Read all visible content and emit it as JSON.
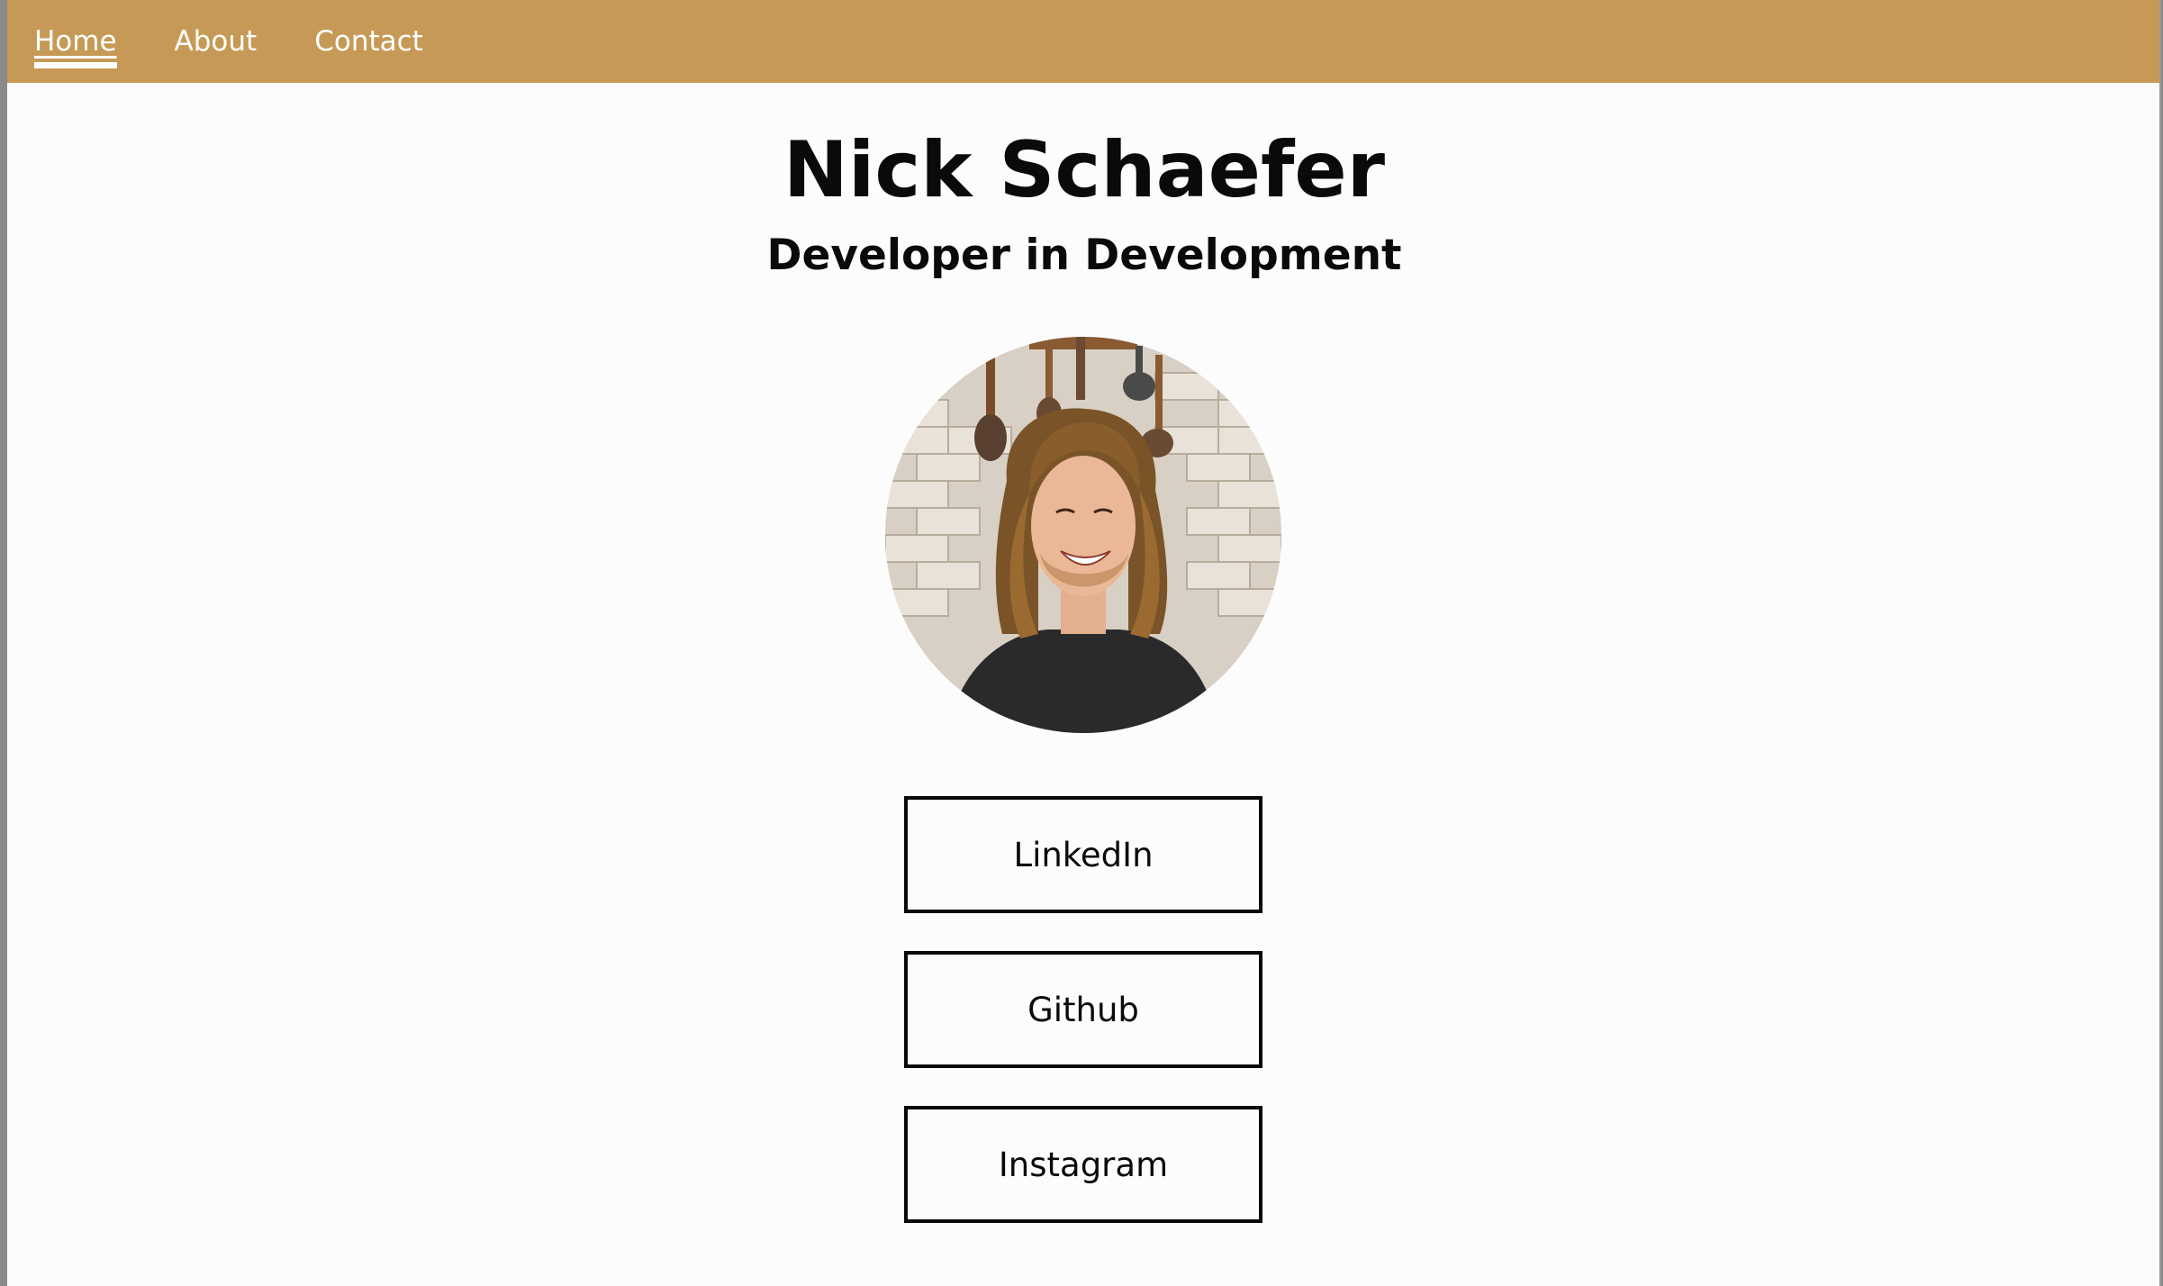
{
  "nav": {
    "items": [
      {
        "label": "Home",
        "active": true
      },
      {
        "label": "About",
        "active": false
      },
      {
        "label": "Contact",
        "active": false
      }
    ]
  },
  "hero": {
    "title": "Nick Schaefer",
    "subtitle": "Developer in Development"
  },
  "buttons": {
    "linkedin": "LinkedIn",
    "github": "Github",
    "instagram": "Instagram"
  },
  "colors": {
    "navbar": "#c69a56",
    "background": "#fcfcfc",
    "text": "#0a0a0a"
  }
}
